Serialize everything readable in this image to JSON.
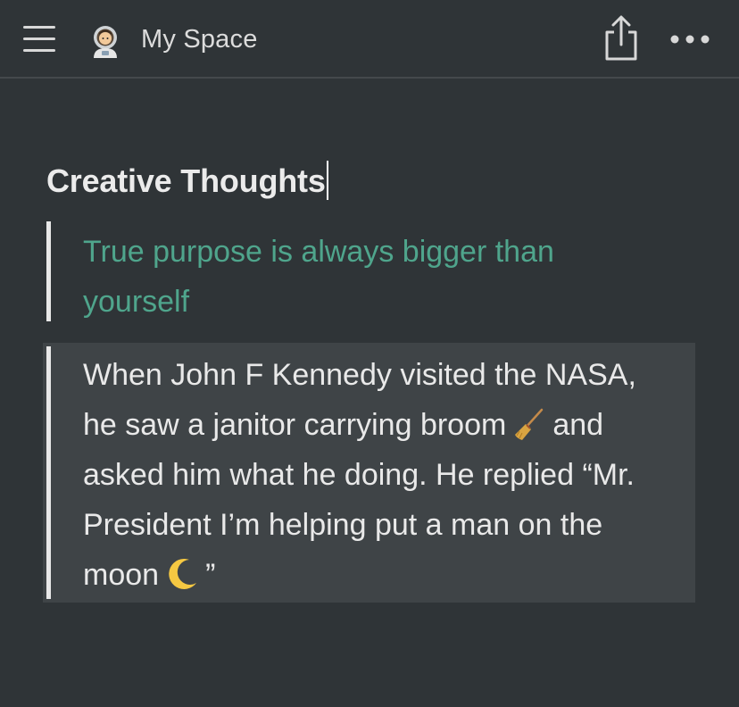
{
  "header": {
    "page_title": "My Space",
    "icons": {
      "menu": "hamburger-menu-icon",
      "page": "astronaut-icon",
      "share": "share-icon",
      "more": "more-icon"
    }
  },
  "document": {
    "heading": "Creative Thoughts",
    "quote": "True purpose is always bigger than yourself",
    "callout": {
      "part1": "When John F Kennedy visited the NASA, he saw a janitor carrying broom",
      "part2": "and asked him what he doing. He replied “Mr. President I’m helping put a man on the moon",
      "part3": "”",
      "emoji_1": "broom-icon",
      "emoji_2": "crescent-moon-icon"
    }
  },
  "colors": {
    "background": "#2f3437",
    "quote_text": "#4fa58c",
    "callout_bg": "#3f4447"
  }
}
